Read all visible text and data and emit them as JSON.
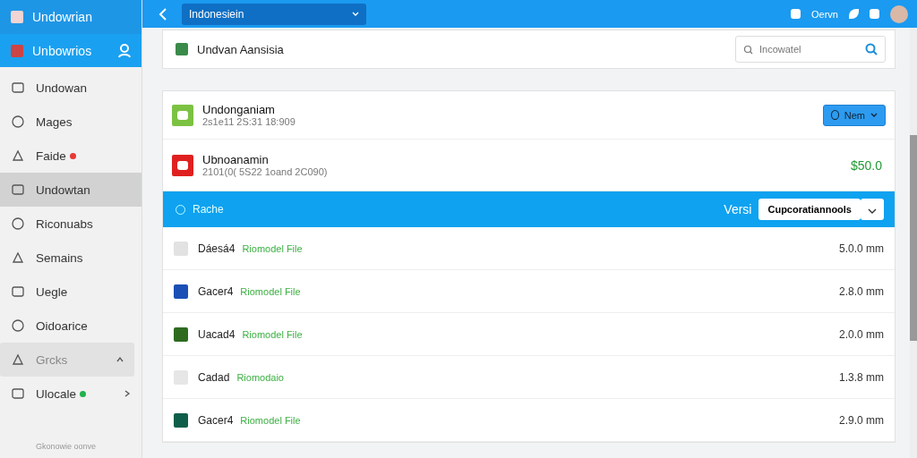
{
  "sidebar": {
    "app_title": "Undowrian",
    "account": {
      "label": "Unbowrios"
    },
    "items": [
      {
        "label": "Undowan",
        "selected": false
      },
      {
        "label": "Mages",
        "selected": false
      },
      {
        "label": "Faide",
        "selected": false,
        "color": "#e53935"
      },
      {
        "label": "Undowtan",
        "selected": true
      },
      {
        "label": "Riconuabs",
        "selected": false
      },
      {
        "label": "Semains",
        "selected": false
      },
      {
        "label": "Uegle",
        "selected": false
      },
      {
        "label": "Oidoarice",
        "selected": false
      },
      {
        "label": "Grcks",
        "selected": false,
        "disabled": true,
        "expanded": true
      },
      {
        "label": "Ulocale",
        "selected": false,
        "color": "#22b14c",
        "expanded": false
      }
    ],
    "footer": "Gkonowie oonve"
  },
  "top_bar": {
    "dropdown": "Indonesiein",
    "user_label": "Oervn"
  },
  "header_card": {
    "title": "Undvan Aansisia",
    "search": {
      "placeholder": "Incowatel"
    }
  },
  "entries": [
    {
      "title": "Undonganiam",
      "subtitle": "2s1e11 2S:31 18:909",
      "kind": "button",
      "action": "Nem",
      "color": "#7cc242"
    },
    {
      "title": "Ubnoanamin",
      "subtitle": "2101(0( 5S22 1oand 2C090)",
      "kind": "price",
      "price": "$50.0",
      "color": "#e02020"
    }
  ],
  "section_bar": {
    "title": "Rache",
    "version_label": "Versi",
    "select": "Cupcoratiannools"
  },
  "files": [
    {
      "name": "Dáesá4",
      "tag": "Riomodel File",
      "size": "5.0.0 mm",
      "color": "#e2e2e2"
    },
    {
      "name": "Gacer4",
      "tag": "Riomodel File",
      "size": "2.8.0 mm",
      "color": "#1a4fb5"
    },
    {
      "name": "Uacad4",
      "tag": "Riomodel File",
      "size": "2.0.0 mm",
      "color": "#2e6b1f"
    },
    {
      "name": "Cadad",
      "tag": "Riomodaio",
      "size": "1.3.8 mm",
      "color": "#e6e6e6"
    },
    {
      "name": "Gacer4",
      "tag": "Riomodel File",
      "size": "2.9.0 mm",
      "color": "#0f5e4a"
    }
  ]
}
